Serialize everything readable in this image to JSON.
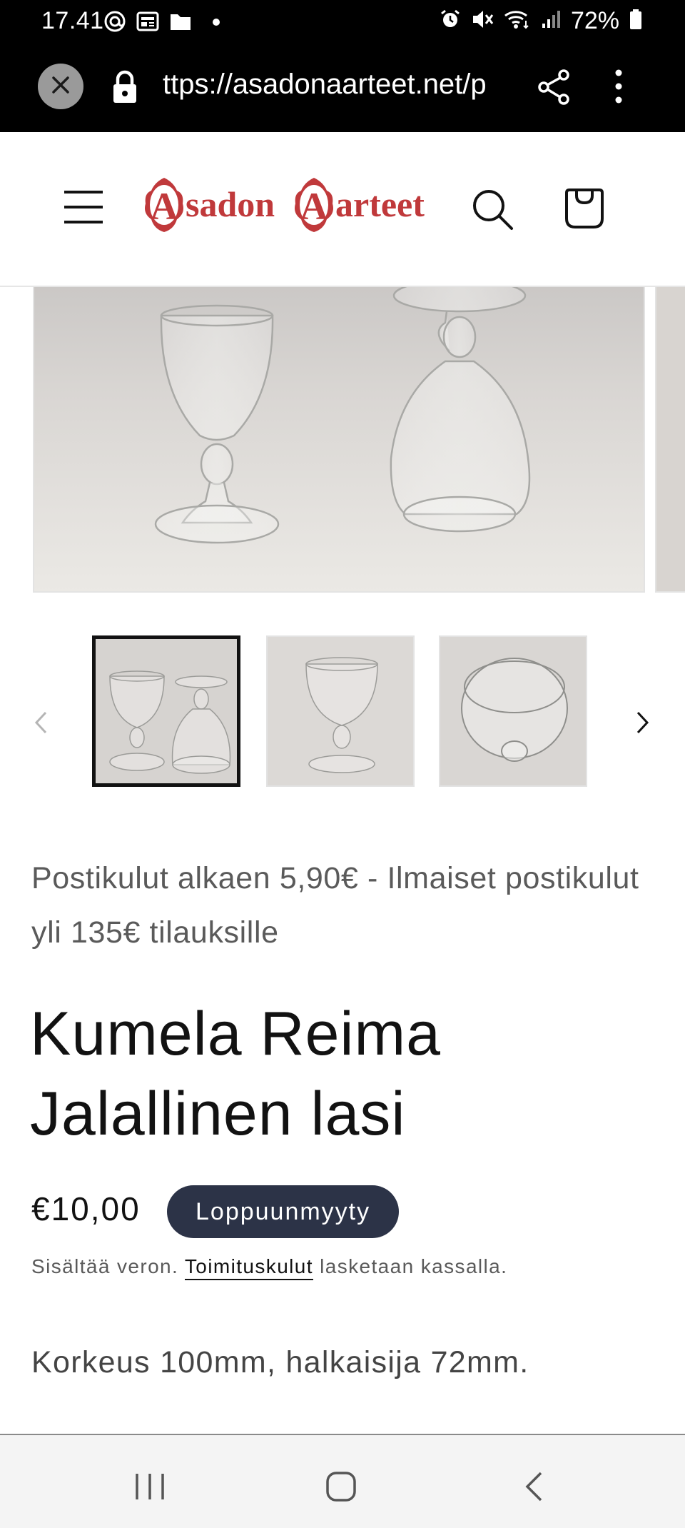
{
  "status_bar": {
    "time": "17.41",
    "battery": "72%",
    "icons": [
      "at-sign-icon",
      "news-icon",
      "folder-icon",
      "dot-icon",
      "alarm-icon",
      "mute-icon",
      "wifi-icon",
      "signal-icon",
      "battery-icon"
    ]
  },
  "browser": {
    "url": "ttps://asadonaarteet.net/p",
    "icons": [
      "close-icon",
      "lock-icon",
      "share-icon",
      "more-vertical-icon"
    ]
  },
  "header": {
    "logo_text_1": "sadon",
    "logo_text_2": "arteet",
    "logo_letter": "A",
    "icons": [
      "menu-icon",
      "search-icon",
      "cart-icon"
    ]
  },
  "gallery": {
    "thumbnail_count": 3,
    "active_index": 0,
    "icons": [
      "chevron-left-icon",
      "chevron-right-icon"
    ]
  },
  "product": {
    "shipping_note": "Postikulut alkaen 5,90€ - Ilmaiset postikulut yli 135€ tilauksille",
    "title": "Kumela Reima Jalallinen lasi",
    "price": "€10,00",
    "badge": "Loppuunmyyty",
    "tax_prefix": "Sisältää veron.",
    "tax_link": "Toimituskulut",
    "tax_suffix": "lasketaan kassalla.",
    "description": "Korkeus 100mm, halkaisija 72mm."
  },
  "colors": {
    "badge_bg": "#2c3347",
    "logo_red": "#c0393b",
    "text_primary": "#121212",
    "text_secondary": "#5a5a5a"
  },
  "nav_bar": {
    "icons": [
      "recents-icon",
      "home-icon",
      "back-icon"
    ]
  }
}
